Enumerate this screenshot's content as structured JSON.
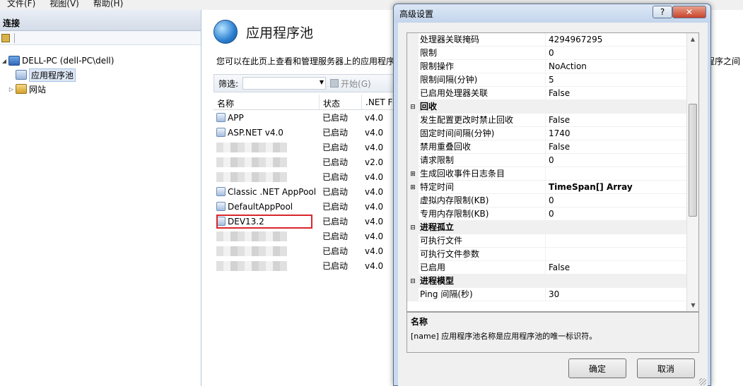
{
  "menu": [
    "文件(F)",
    "视图(V)",
    "帮助(H)"
  ],
  "connections": {
    "header": "连接",
    "tree": [
      {
        "label": "DELL-PC (dell-PC\\dell)",
        "expander": "◢"
      },
      {
        "label": "应用程序池",
        "selected": true
      },
      {
        "label": "网站",
        "expander": "▷"
      }
    ]
  },
  "main": {
    "title": "应用程序池",
    "description": "您可以在此页上查看和管理服务器上的应用程序",
    "description_tail": "程序之间",
    "filter_label": "筛选:",
    "start_label": "开始(G)",
    "columns": [
      "名称",
      "状态",
      ".NET F"
    ],
    "pools": [
      {
        "name": "APP",
        "status": "已启动",
        "net": "v4.0"
      },
      {
        "name": "ASP.NET v4.0",
        "status": "已启动",
        "net": "v4.0"
      },
      {
        "name": "",
        "status": "已启动",
        "net": "v4.0",
        "blurred": true
      },
      {
        "name": "",
        "status": "已启动",
        "net": "v2.0",
        "blurred": true
      },
      {
        "name": "",
        "status": "已启动",
        "net": "v4.0",
        "blurred": true
      },
      {
        "name": "Classic .NET AppPool",
        "status": "已启动",
        "net": "v4.0"
      },
      {
        "name": "DefaultAppPool",
        "status": "已启动",
        "net": "v4.0"
      },
      {
        "name": "DEV13.2",
        "status": "已启动",
        "net": "v4.0",
        "highlighted": true
      },
      {
        "name": "",
        "status": "已启动",
        "net": "v4.0",
        "blurred": true
      },
      {
        "name": "",
        "status": "已启动",
        "net": "v4.0",
        "blurred": true
      },
      {
        "name": "",
        "status": "已启动",
        "net": "v4.0",
        "blurred": true
      }
    ]
  },
  "dialog": {
    "title": "高级设置",
    "help_label": "?",
    "close_label": "✕",
    "properties": [
      {
        "name": "处理器关联掩码",
        "value": "4294967295"
      },
      {
        "name": "限制",
        "value": "0"
      },
      {
        "name": "限制操作",
        "value": "NoAction"
      },
      {
        "name": "限制间隔(分钟)",
        "value": "5"
      },
      {
        "name": "已启用处理器关联",
        "value": "False"
      },
      {
        "name": "回收",
        "value": "",
        "category": true,
        "toggle": "⊟"
      },
      {
        "name": "发生配置更改时禁止回收",
        "value": "False"
      },
      {
        "name": "固定时间间隔(分钟)",
        "value": "1740",
        "highlighted": true
      },
      {
        "name": "禁用重叠回收",
        "value": "False"
      },
      {
        "name": "请求限制",
        "value": "0"
      },
      {
        "name": "生成回收事件日志条目",
        "value": "",
        "toggle": "⊞"
      },
      {
        "name": "特定时间",
        "value": "TimeSpan[] Array",
        "bold": true,
        "highlighted": true,
        "toggle": "⊞"
      },
      {
        "name": "虚拟内存限制(KB)",
        "value": "0"
      },
      {
        "name": "专用内存限制(KB)",
        "value": "0"
      },
      {
        "name": "进程孤立",
        "value": "",
        "category": true,
        "toggle": "⊟"
      },
      {
        "name": "可执行文件",
        "value": ""
      },
      {
        "name": "可执行文件参数",
        "value": ""
      },
      {
        "name": "已启用",
        "value": "False"
      },
      {
        "name": "进程模型",
        "value": "",
        "category": true,
        "toggle": "⊟"
      },
      {
        "name": "Ping 间隔(秒)",
        "value": "30"
      }
    ],
    "description_title": "名称",
    "description_text": "[name] 应用程序池名称是应用程序池的唯一标识符。",
    "ok_label": "确定",
    "cancel_label": "取消"
  },
  "colors": {
    "highlight": "#d9262b",
    "dialog_frame": "#c9d9ee"
  }
}
